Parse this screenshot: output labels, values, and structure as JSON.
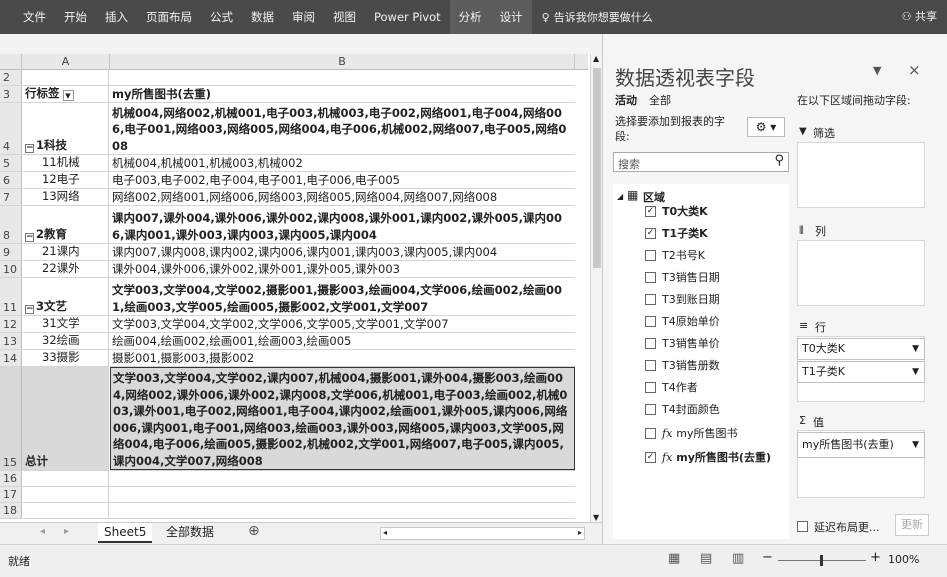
{
  "ribbon": {
    "tabs": [
      "文件",
      "开始",
      "插入",
      "页面布局",
      "公式",
      "数据",
      "审阅",
      "视图",
      "Power Pivot",
      "分析",
      "设计"
    ],
    "tell_me": "告诉我你想要做什么",
    "share": "共享"
  },
  "sheet": {
    "col_a": "A",
    "col_b": "B",
    "rows": [
      {
        "n": "2",
        "a": "",
        "b": ""
      },
      {
        "n": "3",
        "a": "行标签",
        "b": "my所售图书(去重)"
      },
      {
        "n": "4",
        "a": "1科技",
        "b": "机械004,网络002,机械001,电子003,机械003,电子002,网络001,电子004,网络006,电子001,网络003,网络005,网络004,电子006,机械002,网络007,电子005,网络008"
      },
      {
        "n": "5",
        "a": "11机械",
        "b": "机械004,机械001,机械003,机械002"
      },
      {
        "n": "6",
        "a": "12电子",
        "b": "电子003,电子002,电子004,电子001,电子006,电子005"
      },
      {
        "n": "7",
        "a": "13网络",
        "b": "网络002,网络001,网络006,网络003,网络005,网络004,网络007,网络008"
      },
      {
        "n": "8",
        "a": "2教育",
        "b": "课内007,课外004,课外006,课外002,课内008,课外001,课内002,课外005,课内006,课内001,课外003,课内003,课内005,课内004"
      },
      {
        "n": "9",
        "a": "21课内",
        "b": "课内007,课内008,课内002,课内006,课内001,课内003,课内005,课内004"
      },
      {
        "n": "10",
        "a": "22课外",
        "b": "课外004,课外006,课外002,课外001,课外005,课外003"
      },
      {
        "n": "11",
        "a": "3文艺",
        "b": "文学003,文学004,文学002,摄影001,摄影003,绘画004,文学006,绘画002,绘画001,绘画003,文学005,绘画005,摄影002,文学001,文学007"
      },
      {
        "n": "12",
        "a": "31文学",
        "b": "文学003,文学004,文学002,文学006,文学005,文学001,文学007"
      },
      {
        "n": "13",
        "a": "32绘画",
        "b": "绘画004,绘画002,绘画001,绘画003,绘画005"
      },
      {
        "n": "14",
        "a": "33摄影",
        "b": "摄影001,摄影003,摄影002"
      },
      {
        "n": "15",
        "a": "总计",
        "b": "文学003,文学004,文学002,课内007,机械004,摄影001,课外004,摄影003,绘画004,网络002,课外006,课外002,课内008,文学006,机械001,电子003,绘画002,机械003,课外001,电子002,网络001,电子004,课内002,绘画001,课外005,课内006,网络006,课内001,电子001,网络003,绘画003,课外003,网络005,课内003,文学005,网络004,电子006,绘画005,摄影002,机械002,文学001,网络007,电子005,课内005,课内004,文学007,网络008"
      },
      {
        "n": "16",
        "a": "",
        "b": ""
      },
      {
        "n": "17",
        "a": "",
        "b": ""
      },
      {
        "n": "18",
        "a": "",
        "b": ""
      }
    ]
  },
  "sheet_tabs": [
    "Sheet5",
    "全部数据"
  ],
  "status": {
    "ready": "就绪",
    "zoom": "100%"
  },
  "pane": {
    "title": "数据透视表字段",
    "tab_active": "活动",
    "tab_all": "全部",
    "choose_label": "选择要添加到报表的字段:",
    "search_placeholder": "搜索",
    "table_name": "区域",
    "fields": [
      {
        "label": "T0大类K",
        "checked": true,
        "bold": true
      },
      {
        "label": "T1子类K",
        "checked": true,
        "bold": true
      },
      {
        "label": "T2书号K",
        "checked": false,
        "bold": false
      },
      {
        "label": "T3销售日期",
        "checked": false,
        "bold": false
      },
      {
        "label": "T3到账日期",
        "checked": false,
        "bold": false
      },
      {
        "label": "T4原始单价",
        "checked": false,
        "bold": false
      },
      {
        "label": "T3销售单价",
        "checked": false,
        "bold": false
      },
      {
        "label": "T3销售册数",
        "checked": false,
        "bold": false
      },
      {
        "label": "T4作者",
        "checked": false,
        "bold": false
      },
      {
        "label": "T4封面颜色",
        "checked": false,
        "bold": false
      },
      {
        "label": "my所售图书",
        "checked": false,
        "bold": false
      },
      {
        "label": "my所售图书(去重)",
        "checked": true,
        "bold": true
      }
    ],
    "drag_label": "在以下区域间拖动字段:",
    "filter_label": "筛选",
    "column_label": "列",
    "row_label": "行",
    "row_items": [
      "T0大类K",
      "T1子类K"
    ],
    "value_label": "值",
    "value_items": [
      "my所售图书(去重)"
    ],
    "defer_label": "延迟布局更...",
    "update_label": "更新"
  }
}
